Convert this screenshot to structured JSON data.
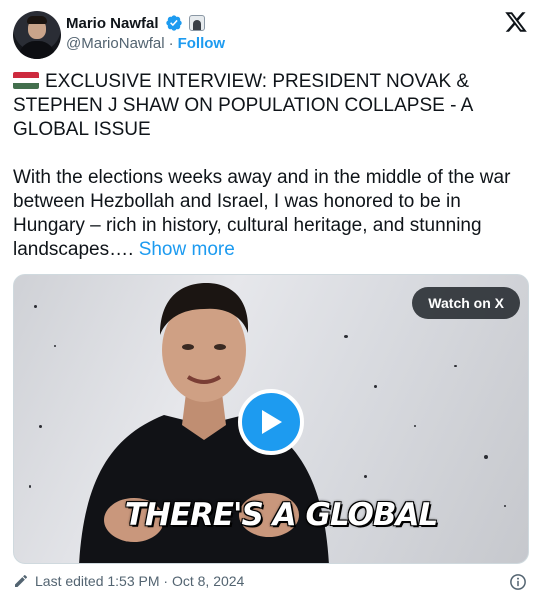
{
  "author": {
    "name": "Mario Nawfal",
    "handle": "@MarioNawfal",
    "separator": "·",
    "follow_label": "Follow",
    "verified_icon": "verified-badge-icon",
    "affiliate_icon": "affiliate-badge-icon"
  },
  "brand": {
    "logo": "x-logo-icon"
  },
  "tweet": {
    "flag_icon": "hungary-flag-icon",
    "headline": "EXCLUSIVE INTERVIEW: PRESIDENT NOVAK & STEPHEN J SHAW ON POPULATION COLLAPSE - A GLOBAL ISSUE",
    "body": "With the elections weeks away and in the middle of the war between Hezbollah and Israel, I was honored to be in Hungary – rich in history, cultural heritage, and stunning landscapes…. ",
    "show_more_label": "Show more"
  },
  "video": {
    "watch_label": "Watch on X",
    "caption": "THERE'S A GLOBAL"
  },
  "footer": {
    "edited_text": "Last edited 1:53 PM · Oct 8, 2024"
  },
  "colors": {
    "accent": "#1d9bf0",
    "text": "#0f1419",
    "muted": "#536471",
    "flag_red": "#cd2a3e",
    "flag_white": "#ffffff",
    "flag_green": "#436f4d"
  }
}
